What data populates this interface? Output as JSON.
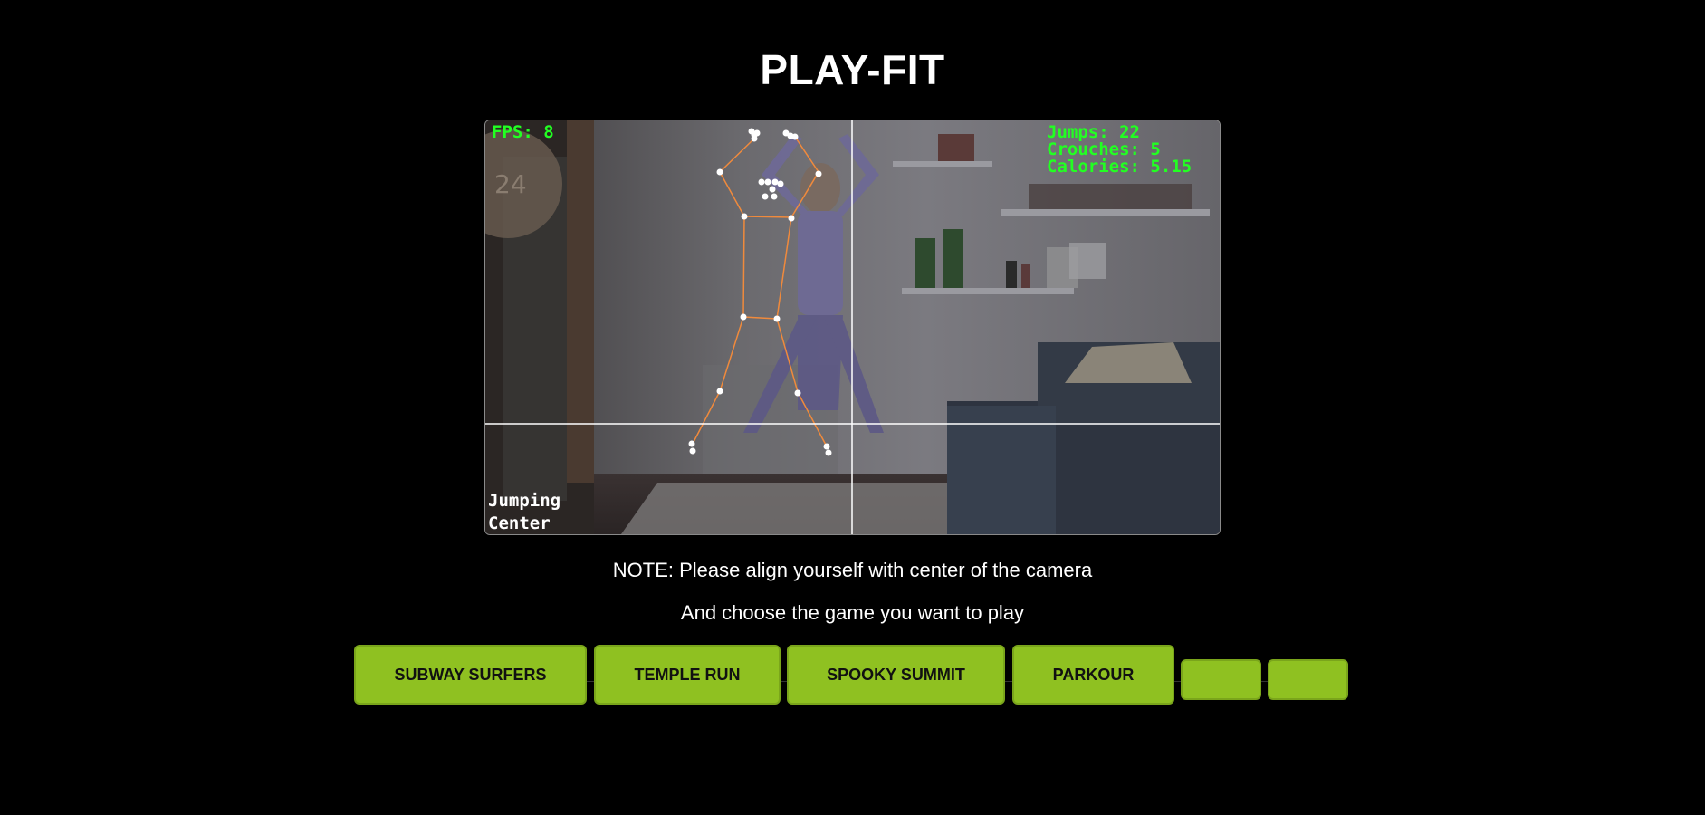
{
  "app": {
    "title": "PLAY-FIT"
  },
  "camera": {
    "fps_label": "FPS: 8",
    "stats": {
      "jumps": "Jumps: 22",
      "crouches": "Crouches: 5",
      "calories": "Calories: 5.15"
    },
    "mode_line1": "Jumping",
    "mode_line2": "Center",
    "wall_number": "24"
  },
  "instructions": {
    "note": "NOTE: Please align yourself with center of the camera",
    "choose": "And choose the game you want to play"
  },
  "games": [
    {
      "label": "SUBWAY SURFERS"
    },
    {
      "label": "TEMPLE RUN"
    },
    {
      "label": "SPOOKY SUMMIT"
    },
    {
      "label": "PARKOUR"
    },
    {
      "label": ""
    },
    {
      "label": ""
    }
  ],
  "colors": {
    "accent": "#8fc121",
    "overlay_text": "#22ff22",
    "skeleton": "#f08a3c"
  }
}
